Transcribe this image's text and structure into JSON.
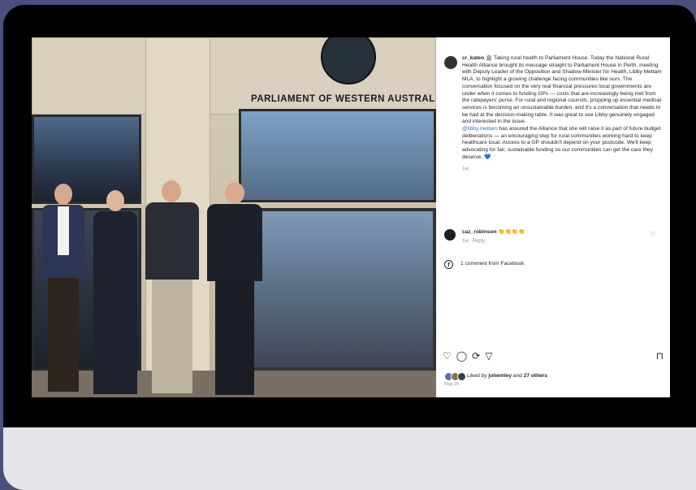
{
  "post": {
    "sign_text": "PARLIAMENT OF WESTERN AUSTRAL",
    "author": "cr_kateo",
    "author_emoji": "🏛️",
    "caption_part1": "Taking rural health to Parliament House. Today the National Rural Health Alliance brought its message straight to Parliament House in Perth, meeting with Deputy Leader of the Opposition and Shadow Minister for Health, Libby Mettam MLA, to highlight a growing challenge facing communities like ours. The conversation focused on the very real financial pressures local governments are under when it comes to funding GPs — costs that are increasingly being met from the ratepayers' purse. For rural and regional councils, propping up essential medical services is becoming an unsustainable burden, and it's a conversation that needs to be had at the decision-making table. It was great to see Libby genuinely engaged and interested in the issue.",
    "caption_mention": "@libby.mettam",
    "caption_part2": "has assured the Alliance that she will raise it as part of future budget deliberations — an encouraging step for rural communities working hard to keep healthcare local. Access to a GP shouldn't depend on your postcode. We'll keep advocating for fair, sustainable funding so our communities can get the care they deserve. 💙",
    "caption_time": "1w",
    "comment": {
      "author": "caz_robinson",
      "text": "👏👏👏👏",
      "time": "1w",
      "reply_label": "Reply"
    },
    "facebook_comments": "1 comment from Facebook",
    "likes_prefix": "Liked by",
    "likes_user": "johemley",
    "likes_and": "and",
    "likes_others": "27 others",
    "date": "May 25",
    "icons": {
      "like": "♡",
      "comment": "◯",
      "share": "⟳",
      "send": "▽",
      "save": "⊓",
      "facebook": "f"
    }
  }
}
